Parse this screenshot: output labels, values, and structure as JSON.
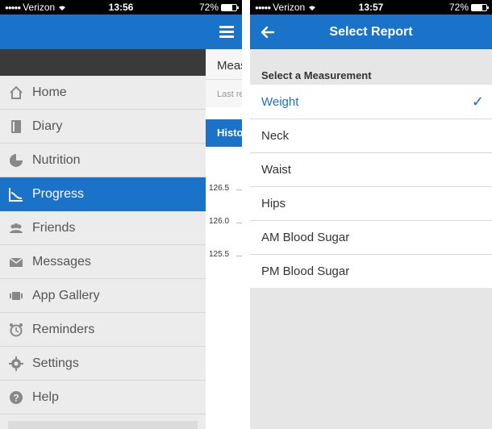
{
  "left_screen": {
    "status": {
      "carrier": "Verizon",
      "time": "13:56",
      "battery": "72%",
      "battery_level": 0.72
    },
    "menu": [
      {
        "label": "Home",
        "icon": "home-icon"
      },
      {
        "label": "Diary",
        "icon": "diary-icon"
      },
      {
        "label": "Nutrition",
        "icon": "pie-chart-icon"
      },
      {
        "label": "Progress",
        "icon": "chart-line-icon",
        "active": true
      },
      {
        "label": "Friends",
        "icon": "friends-icon"
      },
      {
        "label": "Messages",
        "icon": "envelope-icon"
      },
      {
        "label": "App Gallery",
        "icon": "app-gallery-icon"
      },
      {
        "label": "Reminders",
        "icon": "alarm-clock-icon"
      },
      {
        "label": "Settings",
        "icon": "gear-icon"
      },
      {
        "label": "Help",
        "icon": "help-icon"
      }
    ],
    "peek": {
      "row1": "Meas",
      "row2": "Last re",
      "tab": "Histo",
      "ticks": [
        "126.5",
        "126.0",
        "125.5"
      ]
    }
  },
  "right_screen": {
    "status": {
      "carrier": "Verizon",
      "time": "13:57",
      "battery": "72%",
      "battery_level": 0.72
    },
    "title": "Select Report",
    "section_header": "Select a Measurement",
    "options": [
      {
        "label": "Weight",
        "selected": true
      },
      {
        "label": "Neck"
      },
      {
        "label": "Waist"
      },
      {
        "label": "Hips"
      },
      {
        "label": "AM Blood Sugar"
      },
      {
        "label": "PM Blood Sugar"
      }
    ],
    "check_glyph": "✓",
    "colors": {
      "accent": "#1a73c8",
      "background": "#e6e6e6"
    }
  }
}
